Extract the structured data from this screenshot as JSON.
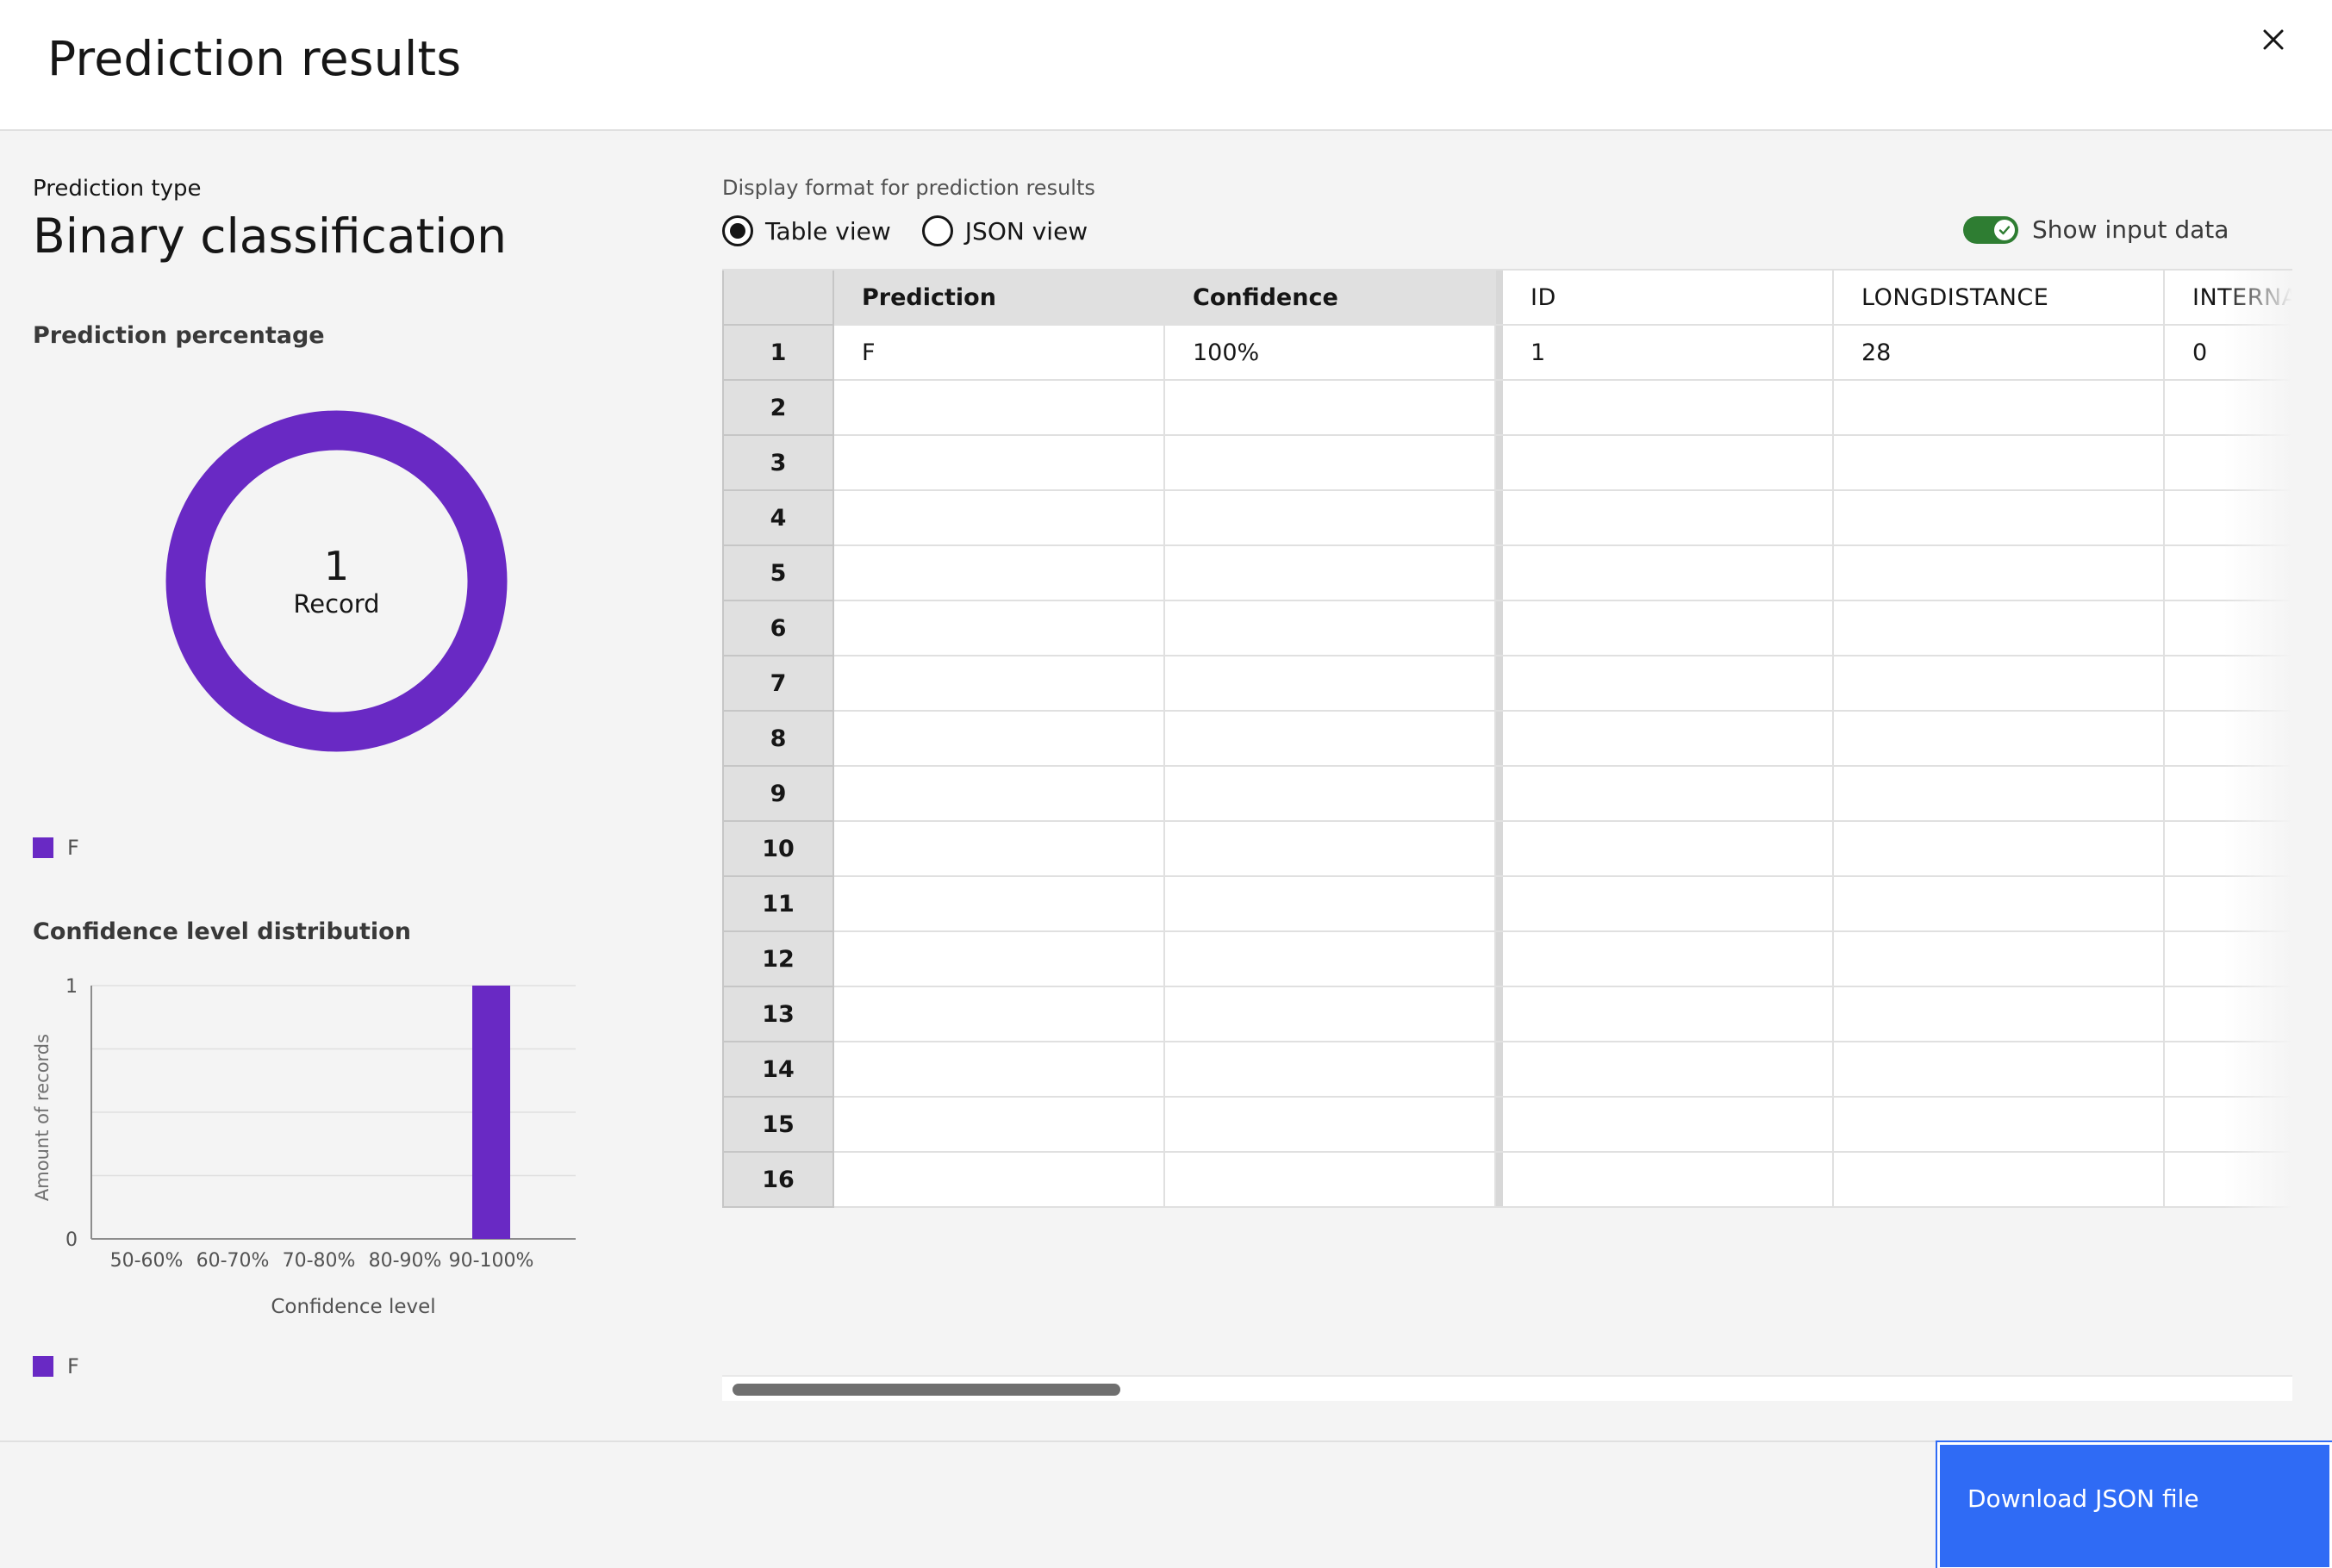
{
  "modal": {
    "title": "Prediction results"
  },
  "prediction": {
    "type_label": "Prediction type",
    "type_value": "Binary classification"
  },
  "donut": {
    "heading": "Prediction percentage",
    "count": "1",
    "unit": "Record",
    "legend": [
      {
        "label": "F",
        "color": "#6929c4"
      }
    ]
  },
  "chart_data": {
    "type": "bar",
    "title": "Confidence level distribution",
    "categories": [
      "50-60%",
      "60-70%",
      "70-80%",
      "80-90%",
      "90-100%"
    ],
    "values": [
      0,
      0,
      0,
      0,
      1
    ],
    "xlabel": "Confidence level",
    "ylabel": "Amount of records",
    "ylim": [
      0,
      1
    ],
    "yticks": [
      "0",
      "1"
    ],
    "grid": true,
    "color": "#6929c4",
    "legend": [
      {
        "label": "F",
        "color": "#6929c4"
      }
    ]
  },
  "display": {
    "format_label": "Display format for prediction results",
    "options": [
      {
        "label": "Table view",
        "selected": true
      },
      {
        "label": "JSON view",
        "selected": false
      }
    ],
    "toggle_label": "Show input data",
    "toggle_on": true,
    "toggle_color": "#2e7d32"
  },
  "table": {
    "columns": [
      "Prediction",
      "Confidence",
      "ID",
      "LONGDISTANCE",
      "INTERNATIONAL"
    ],
    "rows": [
      {
        "n": "1",
        "cells": [
          "F",
          "100%",
          "1",
          "28",
          "0"
        ]
      },
      {
        "n": "2",
        "cells": [
          "",
          "",
          "",
          "",
          ""
        ]
      },
      {
        "n": "3",
        "cells": [
          "",
          "",
          "",
          "",
          ""
        ]
      },
      {
        "n": "4",
        "cells": [
          "",
          "",
          "",
          "",
          ""
        ]
      },
      {
        "n": "5",
        "cells": [
          "",
          "",
          "",
          "",
          ""
        ]
      },
      {
        "n": "6",
        "cells": [
          "",
          "",
          "",
          "",
          ""
        ]
      },
      {
        "n": "7",
        "cells": [
          "",
          "",
          "",
          "",
          ""
        ]
      },
      {
        "n": "8",
        "cells": [
          "",
          "",
          "",
          "",
          ""
        ]
      },
      {
        "n": "9",
        "cells": [
          "",
          "",
          "",
          "",
          ""
        ]
      },
      {
        "n": "10",
        "cells": [
          "",
          "",
          "",
          "",
          ""
        ]
      },
      {
        "n": "11",
        "cells": [
          "",
          "",
          "",
          "",
          ""
        ]
      },
      {
        "n": "12",
        "cells": [
          "",
          "",
          "",
          "",
          ""
        ]
      },
      {
        "n": "13",
        "cells": [
          "",
          "",
          "",
          "",
          ""
        ]
      },
      {
        "n": "14",
        "cells": [
          "",
          "",
          "",
          "",
          ""
        ]
      },
      {
        "n": "15",
        "cells": [
          "",
          "",
          "",
          "",
          ""
        ]
      },
      {
        "n": "16",
        "cells": [
          "",
          "",
          "",
          "",
          ""
        ]
      }
    ]
  },
  "footer": {
    "download_label": "Download JSON file",
    "download_color": "#2f6bf5"
  }
}
